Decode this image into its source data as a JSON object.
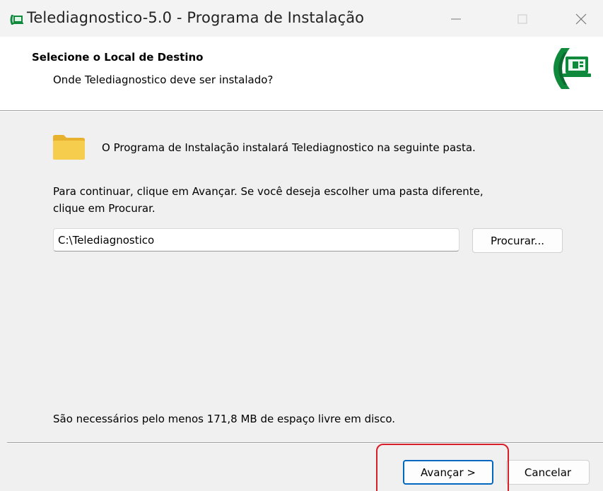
{
  "window": {
    "title": "Telediagnostico-5.0 - Programa de Instalação",
    "app_icon": "laptop-logo-icon",
    "controls": [
      "minimize-icon",
      "maximize-icon",
      "close-icon"
    ]
  },
  "header": {
    "title": "Selecione o Local de Destino",
    "subtitle": "Onde Telediagnostico deve ser instalado?",
    "logo": "telediagnostico-logo"
  },
  "body": {
    "folder_icon": "folder-icon",
    "info": "O Programa de Instalação instalará Telediagnostico na seguinte pasta.",
    "instructions_line1": "Para continuar, clique em Avançar. Se você deseja escolher uma pasta diferente,",
    "instructions_line2": "clique em Procurar.",
    "path_value": "C:\\Telediagnostico",
    "browse_label": "Procurar...",
    "space_required": "São necessários pelo menos 171,8 MB de espaço livre em disco."
  },
  "footer": {
    "next_label": "Avançar >",
    "cancel_label": "Cancelar"
  },
  "colors": {
    "accent": "#0067c0",
    "highlight": "#d81e28",
    "logo_green": "#0f8a3c"
  }
}
